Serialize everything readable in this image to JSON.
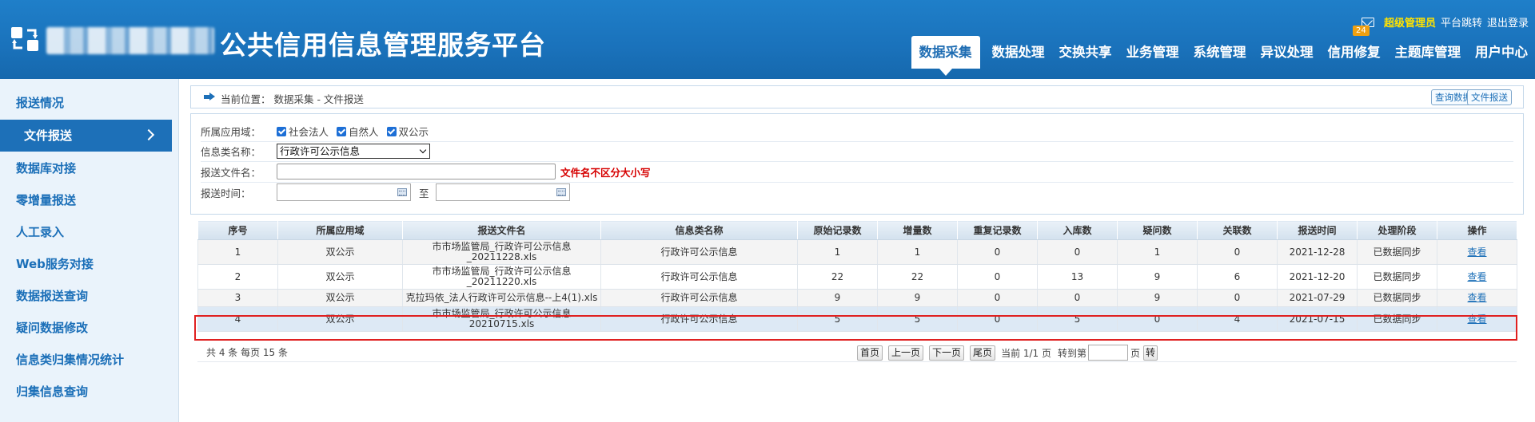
{
  "header": {
    "platform_title": "公共信用信息管理服务平台",
    "notification_count": "24",
    "admin_label": "超级管理员",
    "switch_label": "平台跳转",
    "logout_label": "退出登录",
    "nav": [
      "数据采集",
      "数据处理",
      "交换共享",
      "业务管理",
      "系统管理",
      "异议处理",
      "信用修复",
      "主题库管理",
      "用户中心"
    ],
    "active_nav": "数据采集"
  },
  "sidebar": {
    "items": [
      "报送情况",
      "文件报送",
      "数据库对接",
      "零增量报送",
      "人工录入",
      "Web服务对接",
      "数据报送查询",
      "疑问数据修改",
      "信息类归集情况统计",
      "归集信息查询"
    ],
    "active_item": "文件报送"
  },
  "breadcrumb": {
    "text": "当前位置： 数据采集 - 文件报送",
    "btn_query": "查询数据",
    "btn_upload": "文件报送"
  },
  "filter": {
    "domain_label": "所属应用域：",
    "domain_options": [
      "社会法人",
      "自然人",
      "双公示"
    ],
    "info_label": "信息类名称：",
    "info_value": "行政许可公示信息",
    "filename_label": "报送文件名：",
    "filename_value": "",
    "filename_hint": "文件名不区分大小写",
    "time_label": "报送时间：",
    "time_from": "",
    "time_to_label": "至",
    "time_to": ""
  },
  "table": {
    "columns": [
      "序号",
      "所属应用域",
      "报送文件名",
      "信息类名称",
      "原始记录数",
      "增量数",
      "重复记录数",
      "入库数",
      "疑问数",
      "关联数",
      "报送时间",
      "处理阶段",
      "操作"
    ],
    "rows": [
      [
        "1",
        "双公示",
        "市市场监管局_行政许可公示信息\n_20211228.xls",
        "行政许可公示信息",
        "1",
        "1",
        "0",
        "0",
        "1",
        "0",
        "2021-12-28",
        "已数据同步",
        "查看"
      ],
      [
        "2",
        "双公示",
        "市市场监管局_行政许可公示信息\n_20211220.xls",
        "行政许可公示信息",
        "22",
        "22",
        "0",
        "13",
        "9",
        "6",
        "2021-12-20",
        "已数据同步",
        "查看"
      ],
      [
        "3",
        "双公示",
        "克拉玛依_法人行政许可公示信息--上4(1).xls",
        "行政许可公示信息",
        "9",
        "9",
        "0",
        "0",
        "9",
        "0",
        "2021-07-29",
        "已数据同步",
        "查看"
      ],
      [
        "4",
        "双公示",
        "市市场监管局_行政许可公示信息\n20210715.xls",
        "行政许可公示信息",
        "5",
        "5",
        "0",
        "5",
        "0",
        "4",
        "2021-07-15",
        "已数据同步",
        "查看"
      ]
    ]
  },
  "pager": {
    "summary": "共 4 条  每页 15 条",
    "first": "首页",
    "prev": "上一页",
    "next": "下一页",
    "last": "尾页",
    "current": "当前 1/1 页",
    "goto_label": "转到第",
    "page_suffix": "页",
    "go": "转"
  }
}
